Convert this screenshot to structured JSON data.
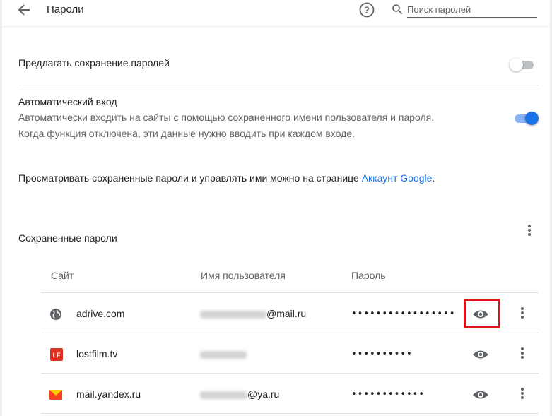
{
  "header": {
    "title": "Пароли",
    "search_placeholder": "Поиск паролей"
  },
  "settings": {
    "offer_save": {
      "label": "Предлагать сохранение паролей",
      "enabled": false
    },
    "auto_signin": {
      "title": "Автоматический вход",
      "description_line1": "Автоматически входить на сайты с помощью сохраненного имени пользователя и пароля.",
      "description_line2": "Когда функция отключена, эти данные нужно вводить при каждом входе.",
      "enabled": true
    },
    "manage_text": "Просматривать сохраненные пароли и управлять ими можно на странице",
    "manage_link": "Аккаунт Google",
    "manage_period": "."
  },
  "saved": {
    "heading": "Сохраненные пароли",
    "columns": {
      "site": "Сайт",
      "username": "Имя пользователя",
      "password": "Пароль"
    },
    "rows": [
      {
        "site": "adrive.com",
        "username_suffix": "@mail.ru",
        "password": "•••••••••••••••••",
        "icon": "globe-icon"
      },
      {
        "site": "lostfilm.tv",
        "username_suffix": "",
        "password": "••••••••••",
        "icon": "lostfilm-favicon"
      },
      {
        "site": "mail.yandex.ru",
        "username_suffix": "@ya.ru",
        "password": "••••••••••••",
        "icon": "yandex-mail-favicon"
      }
    ]
  },
  "colors": {
    "accent": "#1a73e8",
    "highlight": "#e0131b",
    "text": "#202124",
    "muted": "#5f6368"
  }
}
